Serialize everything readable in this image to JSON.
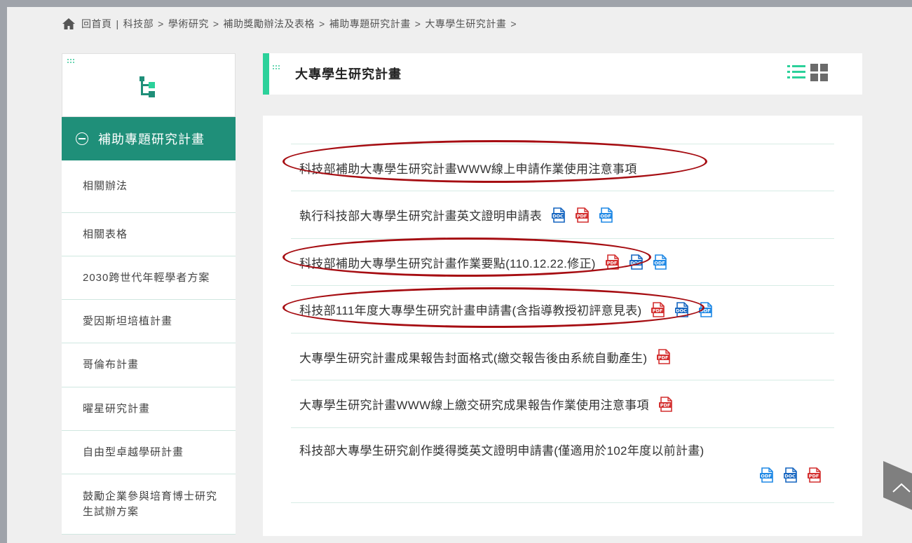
{
  "breadcrumb": {
    "home": "回首頁",
    "divider": "|",
    "items": [
      "科技部",
      "學術研究",
      "補助獎勵辦法及表格",
      "補助專題研究計畫",
      "大專學生研究計畫"
    ],
    "separator": ">"
  },
  "sidebar": {
    "active_label": "補助專題研究計畫",
    "items": [
      {
        "label": "相關辦法"
      },
      {
        "label": "相關表格"
      },
      {
        "label": "2030跨世代年輕學者方案"
      },
      {
        "label": "愛因斯坦培植計畫"
      },
      {
        "label": "哥倫布計畫"
      },
      {
        "label": "曜星研究計畫"
      },
      {
        "label": "自由型卓越學研計畫"
      },
      {
        "label": "鼓勵企業參與培育博士研究生試辦方案"
      }
    ]
  },
  "content": {
    "title": "大專學生研究計畫",
    "rows": [
      {
        "text": "科技部補助大專學生研究計畫WWW線上申請作業使用注意事項",
        "icons": []
      },
      {
        "text": "執行科技部大專學生研究計畫英文證明申請表",
        "icons": [
          "doc",
          "pdf",
          "odf"
        ]
      },
      {
        "text": "科技部補助大專學生研究計畫作業要點(110.12.22.修正)",
        "icons": [
          "pdf",
          "doc",
          "odf"
        ]
      },
      {
        "text": "科技部111年度大專學生研究計畫申請書(含指導教授初評意見表)",
        "icons": [
          "pdf",
          "doc",
          "odf"
        ]
      },
      {
        "text": "大專學生研究計畫成果報告封面格式(繳交報告後由系統自動產生)",
        "icons": [
          "pdf"
        ]
      },
      {
        "text": "大專學生研究計畫WWW線上繳交研究成果報告作業使用注意事項",
        "icons": [
          "pdf"
        ]
      },
      {
        "text": "科技部大專學生研究創作獎得獎英文證明申請書(僅適用於102年度以前計畫)",
        "icons": [
          "odf",
          "doc",
          "pdf"
        ]
      }
    ]
  },
  "icon_labels": {
    "doc": "DOC",
    "pdf": "PDF",
    "odf": "ODF"
  },
  "colors": {
    "accent_green": "#1f8f79",
    "bar_green": "#2bd19a",
    "doc_blue": "#1565c0",
    "odf_blue": "#1e88e5",
    "pdf_red": "#d32f2f",
    "annotation_red": "#a60d12"
  }
}
